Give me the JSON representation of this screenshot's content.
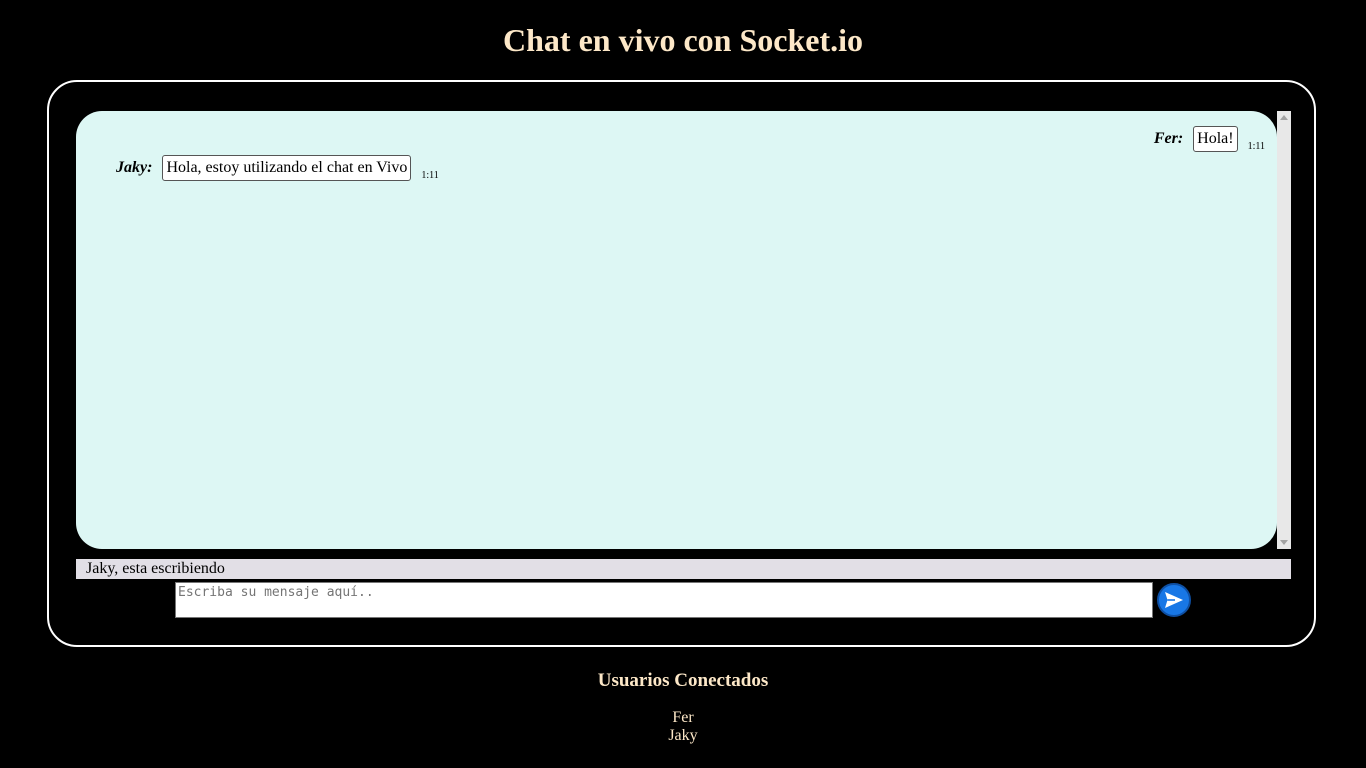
{
  "header": {
    "title": "Chat en vivo con Socket.io"
  },
  "chat": {
    "messages": [
      {
        "author": "Fer:",
        "text": "Hola!",
        "time": "1:11",
        "align": "right"
      },
      {
        "author": "Jaky:",
        "text": "Hola, estoy utilizando el chat en Vivo",
        "time": "1:11",
        "align": "left"
      }
    ],
    "typing_status": "Jaky, esta escribiendo",
    "input": {
      "value": "",
      "placeholder": "Escriba su mensaje aquí.."
    },
    "send_button_icon": "send-arrow-icon"
  },
  "users": {
    "title": "Usuarios Conectados",
    "list": [
      "Fer",
      "Jaky"
    ]
  },
  "colors": {
    "background": "#000000",
    "heading_text": "#fde8c8",
    "messages_background": "#ddf7f4",
    "typing_bar": "#e2dfe6",
    "send_button": "#1877e6"
  }
}
